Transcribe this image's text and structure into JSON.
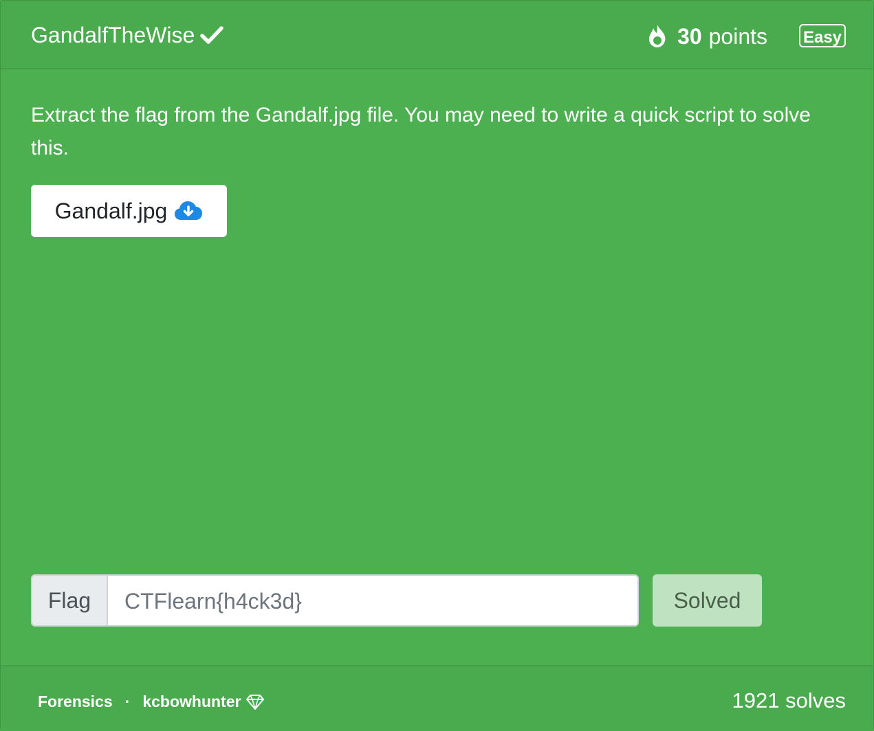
{
  "challenge": {
    "title": "GandalfTheWise",
    "points_value": "30",
    "points_unit": "points",
    "difficulty": "Easy",
    "description": "Extract the flag from the Gandalf.jpg file. You may need to write a quick script to solve this.",
    "file_name": "Gandalf.jpg"
  },
  "flag_form": {
    "label": "Flag",
    "value": "CTFlearn{h4ck3d}",
    "submit_label": "Solved"
  },
  "footer": {
    "category": "Forensics",
    "separator": "·",
    "author": "kcbowhunter",
    "solves": "1921 solves"
  },
  "icons": {
    "solved": "check-icon",
    "points": "fire-icon",
    "download": "cloud-download-icon",
    "author_badge": "gem-icon"
  },
  "colors": {
    "card_background": "#4caf50",
    "download_icon": "#1e88e5",
    "solved_button": "#bfe3c1"
  }
}
